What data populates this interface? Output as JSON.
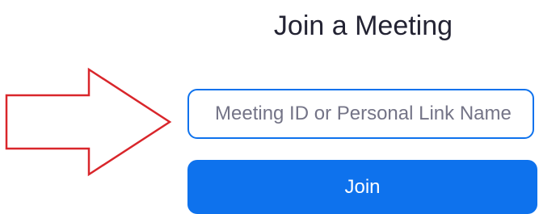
{
  "header": {
    "title": "Join a Meeting"
  },
  "meeting_input": {
    "placeholder": "Meeting ID or Personal Link Name",
    "value": ""
  },
  "join_button": {
    "label": "Join"
  },
  "annotation": {
    "icon": "red-arrow-icon",
    "color": "#d9262b"
  },
  "colors": {
    "accent": "#0e72ed",
    "title_text": "#232333",
    "placeholder_text": "#747487"
  }
}
